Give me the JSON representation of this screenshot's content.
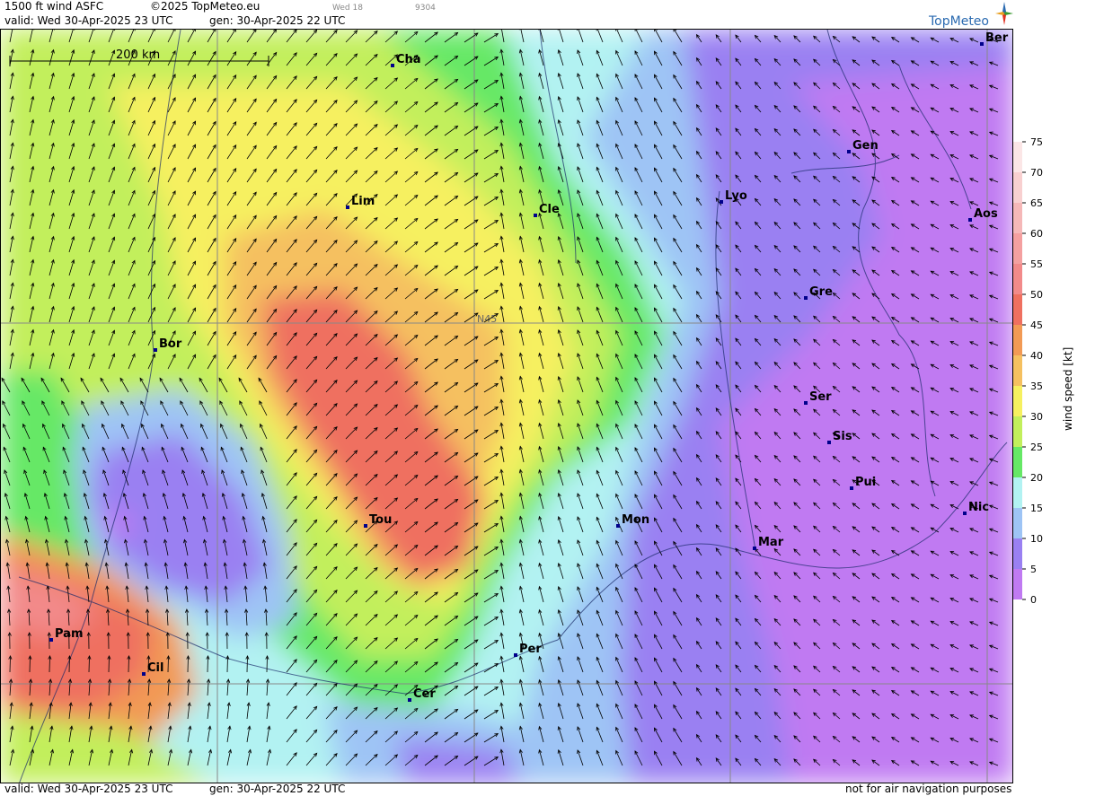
{
  "header": {
    "title": "1500 ft wind ASFC",
    "copyright": "©2025 TopMeteo.eu",
    "valid": "valid:  Wed  30-Apr-2025  23 UTC",
    "gen": "gen: 30-Apr-2025 22 UTC",
    "day_code": "Wed 18",
    "run_code": "9304",
    "brand": "TopMeteo"
  },
  "footer": {
    "valid": "valid:  Wed  30-Apr-2025  23 UTC",
    "gen": "gen: 30-Apr-2025 22 UTC",
    "disclaimer": "not for air navigation purposes"
  },
  "map": {
    "scale_label": "200 km",
    "lat_label": "N45",
    "cities": [
      {
        "name": "Ber"
      },
      {
        "name": "Cha"
      },
      {
        "name": "Gen"
      },
      {
        "name": "Lim"
      },
      {
        "name": "Cle"
      },
      {
        "name": "Lyo"
      },
      {
        "name": "Aos"
      },
      {
        "name": "Gre"
      },
      {
        "name": "Bor"
      },
      {
        "name": "Ser"
      },
      {
        "name": "Sis"
      },
      {
        "name": "Pui"
      },
      {
        "name": "Tou"
      },
      {
        "name": "Mon"
      },
      {
        "name": "Nic"
      },
      {
        "name": "Mar"
      },
      {
        "name": "Pam"
      },
      {
        "name": "Cil"
      },
      {
        "name": "Per"
      },
      {
        "name": "Cer"
      }
    ]
  },
  "legend": {
    "title": "wind speed [kt]",
    "levels": [
      "75",
      "70",
      "65",
      "60",
      "55",
      "50",
      "45",
      "40",
      "35",
      "30",
      "25",
      "20",
      "15",
      "10",
      "5",
      "0"
    ],
    "colors": [
      "#fff",
      "#fbe6e6",
      "#f8d0d0",
      "#f5b8b8",
      "#f4a0a0",
      "#f28a8a",
      "#ef7060",
      "#f29a55",
      "#f5c060",
      "#f6f060",
      "#c2ef5c",
      "#66e866",
      "#b2f2f2",
      "#9ec4f5",
      "#9a80f2",
      "#c07af2"
    ]
  }
}
